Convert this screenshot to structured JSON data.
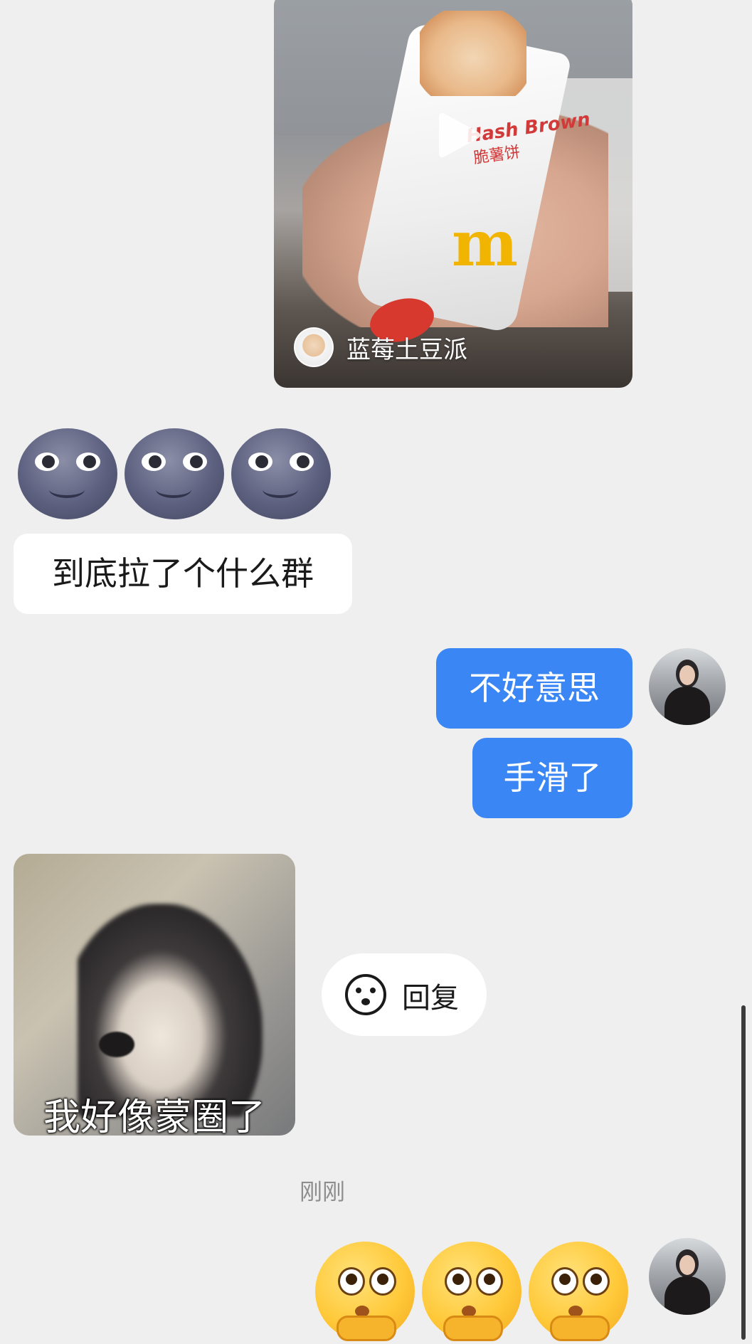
{
  "video_share": {
    "creator_name": "蓝莓土豆派",
    "bag_brand": "Hash Brown",
    "bag_label": "脆薯饼"
  },
  "messages": {
    "incoming_text": "到底拉了个什么群",
    "outgoing_1": "不好意思",
    "outgoing_2": "手滑了",
    "sticker_caption": "我好像蒙圈了"
  },
  "reply_action": {
    "label": "回复"
  },
  "timestamp": "刚刚",
  "colors": {
    "background": "#efefef",
    "outgoing_bubble": "#3a86f4",
    "incoming_bubble": "#ffffff"
  }
}
